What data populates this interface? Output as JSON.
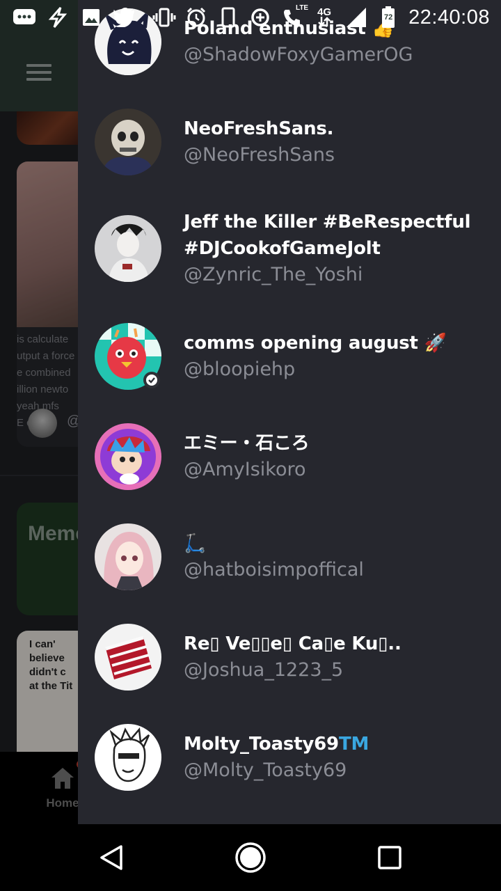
{
  "status_bar": {
    "time": "22:40:08",
    "lte_label": "LTE",
    "network_label": "4G",
    "battery_level": "72",
    "icons": [
      "chat-icon",
      "bolt-icon",
      "image-icon",
      "twitter-icon",
      "vibrate-icon",
      "alarm-icon",
      "phone-outline-icon",
      "data-saver-icon",
      "call-icon",
      "signal-icon",
      "battery-icon"
    ]
  },
  "background": {
    "card_text_lines": [
      "is calculate",
      "utput a force",
      "e combined",
      "illion newto",
      "yeah mfs",
      "E c   EA"
    ],
    "card_at": "@",
    "memes_label": "Meme",
    "meme_text_lines": [
      "I can'",
      "believe",
      "didn't c",
      "at the Tit"
    ],
    "nav_home_label": "Home"
  },
  "drawer": {
    "users": [
      {
        "name": "Poland enthusiast 👍",
        "handle": "@ShadowFoxyGamerOG",
        "avatar": "ghost-avatar"
      },
      {
        "name": "NeoFreshSans.",
        "handle": "@NeoFreshSans",
        "avatar": "skeleton-avatar"
      },
      {
        "name_line1": "Jeff the Killer #BeRespectful",
        "name_line2": "#DJCookofGameJolt",
        "handle": "@Zynric_The_Yoshi",
        "avatar": "jeff-avatar"
      },
      {
        "name": "comms opening august 🚀",
        "handle": "@bloopiehp",
        "avatar": "bird-avatar",
        "verified": true
      },
      {
        "name": "エミー・石ころ",
        "handle": "@AmyIsikoro",
        "avatar": "boyfriend-avatar"
      },
      {
        "name": "🛴",
        "handle": "@hatboisimpoffical",
        "avatar": "anime-girl-avatar"
      },
      {
        "name": "Re▯ Ve▯▯e▯ Ca▯e Ku▯..",
        "handle": "@Joshua_1223_5",
        "avatar": "cake-avatar"
      },
      {
        "name": "Molty_Toasty69",
        "name_suffix": "TM",
        "handle": "@Molty_Toasty69",
        "avatar": "sketch-face-avatar"
      }
    ]
  },
  "colors": {
    "drawer_bg": "#26272e",
    "handle_gray": "#8b8d95",
    "tm_blue": "#3aa7e0",
    "header_green": "#2b3b35"
  }
}
